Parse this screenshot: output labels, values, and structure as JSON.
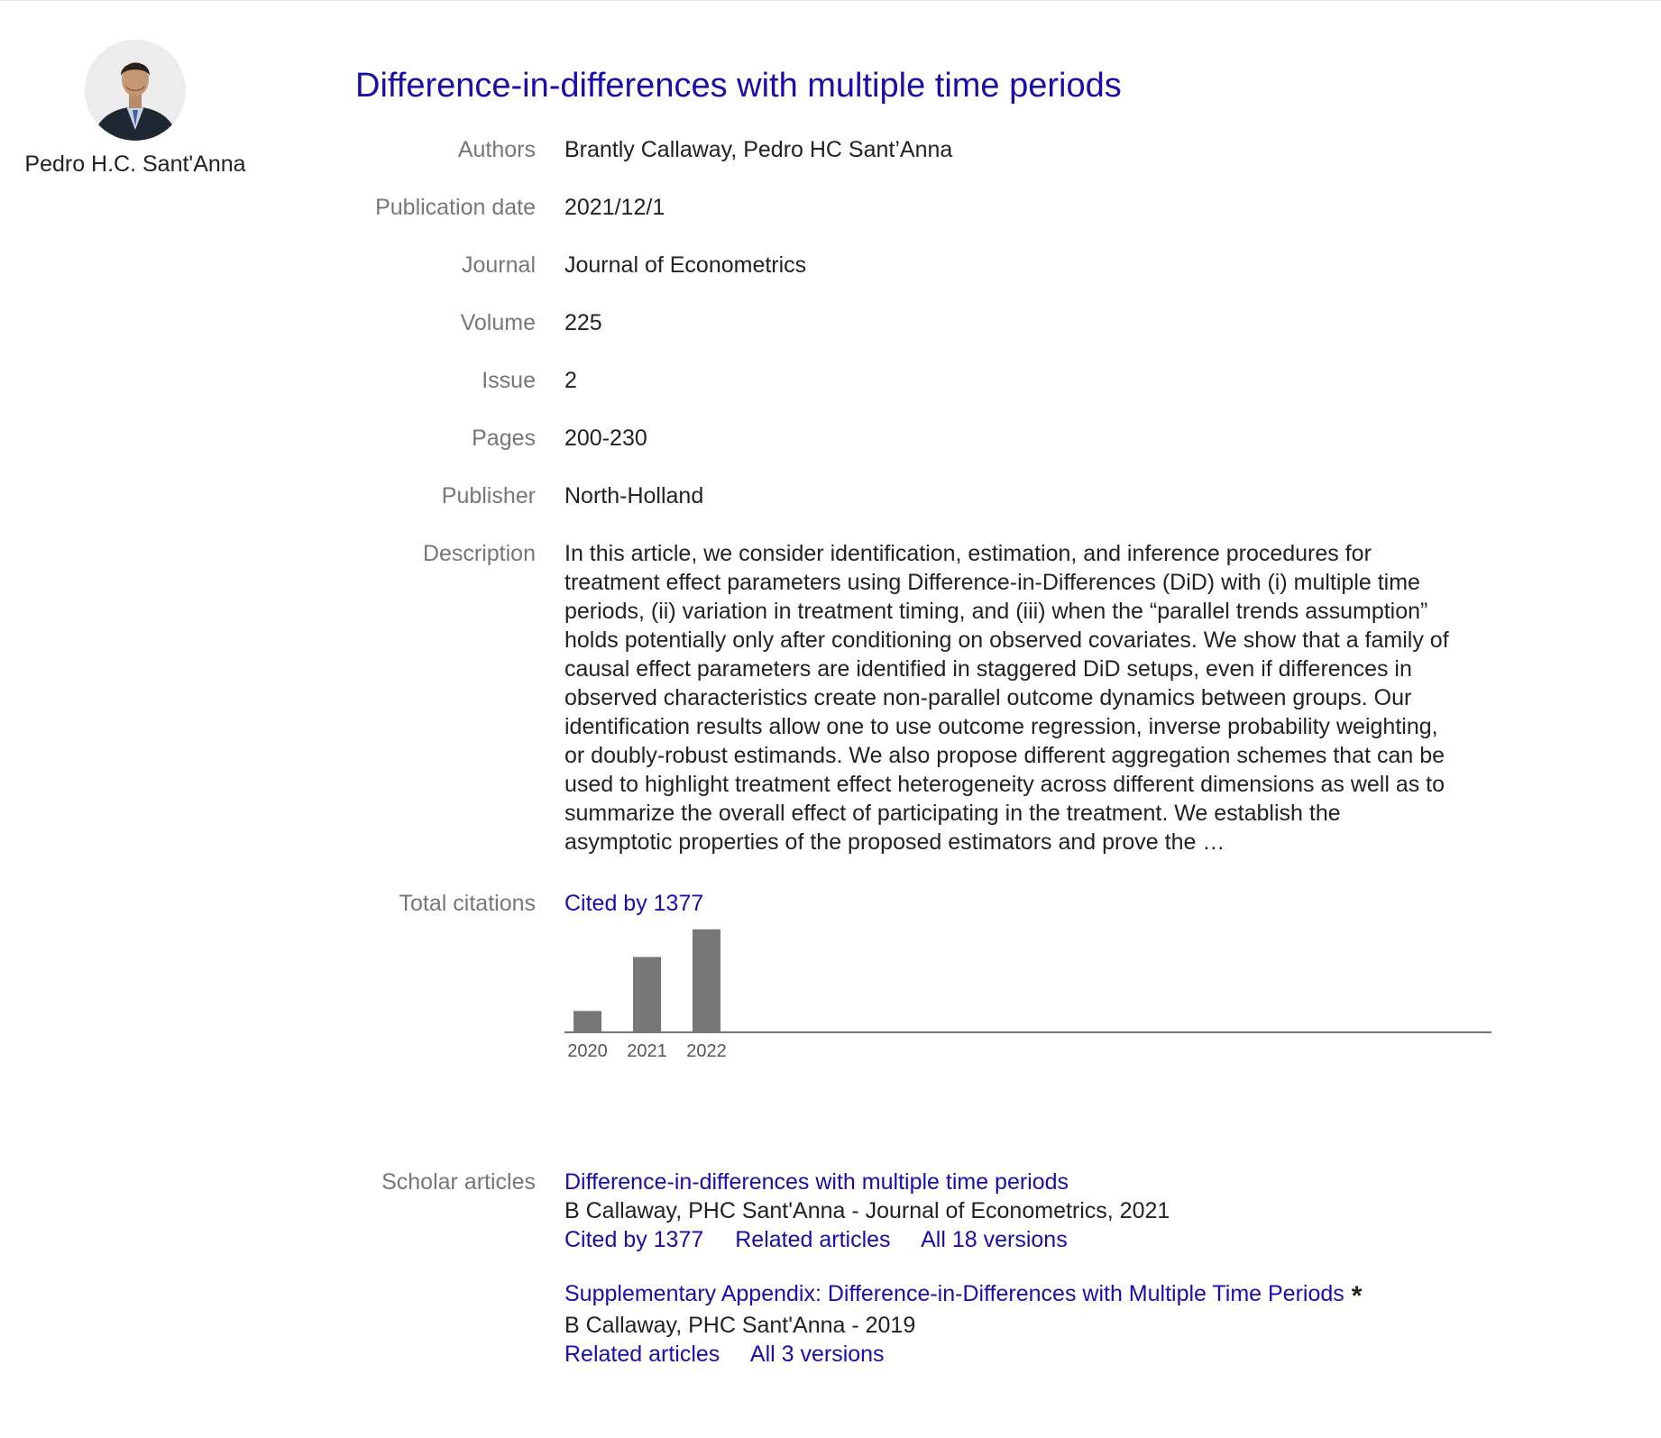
{
  "profile": {
    "name": "Pedro H.C. Sant'Anna"
  },
  "title": "Difference-in-differences with multiple time periods",
  "fields": [
    {
      "label": "Authors",
      "value": "Brantly Callaway, Pedro HC Sant’Anna"
    },
    {
      "label": "Publication date",
      "value": "2021/12/1"
    },
    {
      "label": "Journal",
      "value": "Journal of Econometrics"
    },
    {
      "label": "Volume",
      "value": "225"
    },
    {
      "label": "Issue",
      "value": "2"
    },
    {
      "label": "Pages",
      "value": "200-230"
    },
    {
      "label": "Publisher",
      "value": "North-Holland"
    }
  ],
  "description": {
    "label": "Description",
    "lines": [
      "In this article, we consider identification, estimation, and inference procedures for",
      "treatment effect parameters using Difference-in-Differences (DiD) with (i) multiple time",
      "periods, (ii) variation in treatment timing, and (iii) when the “parallel trends assumption”",
      "holds potentially only after conditioning on observed covariates. We show that a family of",
      "causal effect parameters are identified in staggered DiD setups, even if differences in",
      "observed characteristics create non-parallel outcome dynamics between groups. Our",
      "identification results allow one to use outcome regression, inverse probability weighting,",
      "or doubly-robust estimands. We also propose different aggregation schemes that can be",
      "used to highlight treatment effect heterogeneity across different dimensions as well as to",
      "summarize the overall effect of participating in the treatment. We establish the",
      "asymptotic properties of the proposed estimators and prove the …"
    ]
  },
  "citations": {
    "label": "Total citations",
    "link": "Cited by 1377"
  },
  "chart_data": {
    "type": "bar",
    "categories": [
      "2020",
      "2021",
      "2022"
    ],
    "values": [
      85,
      300,
      410
    ],
    "ylim": [
      0,
      420
    ],
    "grid": false,
    "title": "",
    "xlabel": "",
    "ylabel": "",
    "colors": {
      "bar": "#777777",
      "axis": "#777777",
      "tick": "#555555"
    }
  },
  "scholar": {
    "label": "Scholar articles",
    "articles": [
      {
        "title": "Difference-in-differences with multiple time periods",
        "meta": "B Callaway, PHC Sant'Anna - Journal of Econometrics, 2021",
        "links": [
          "Cited by 1377",
          "Related articles",
          "All 18 versions"
        ],
        "star": ""
      },
      {
        "title": "Supplementary Appendix: Difference-in-Differences with Multiple Time Periods",
        "meta": "B Callaway, PHC Sant'Anna - 2019",
        "links": [
          "Related articles",
          "All 3 versions"
        ],
        "star": "*"
      }
    ]
  },
  "colors": {
    "link": "#1a0dab",
    "label": "#777777",
    "text": "#222222"
  }
}
